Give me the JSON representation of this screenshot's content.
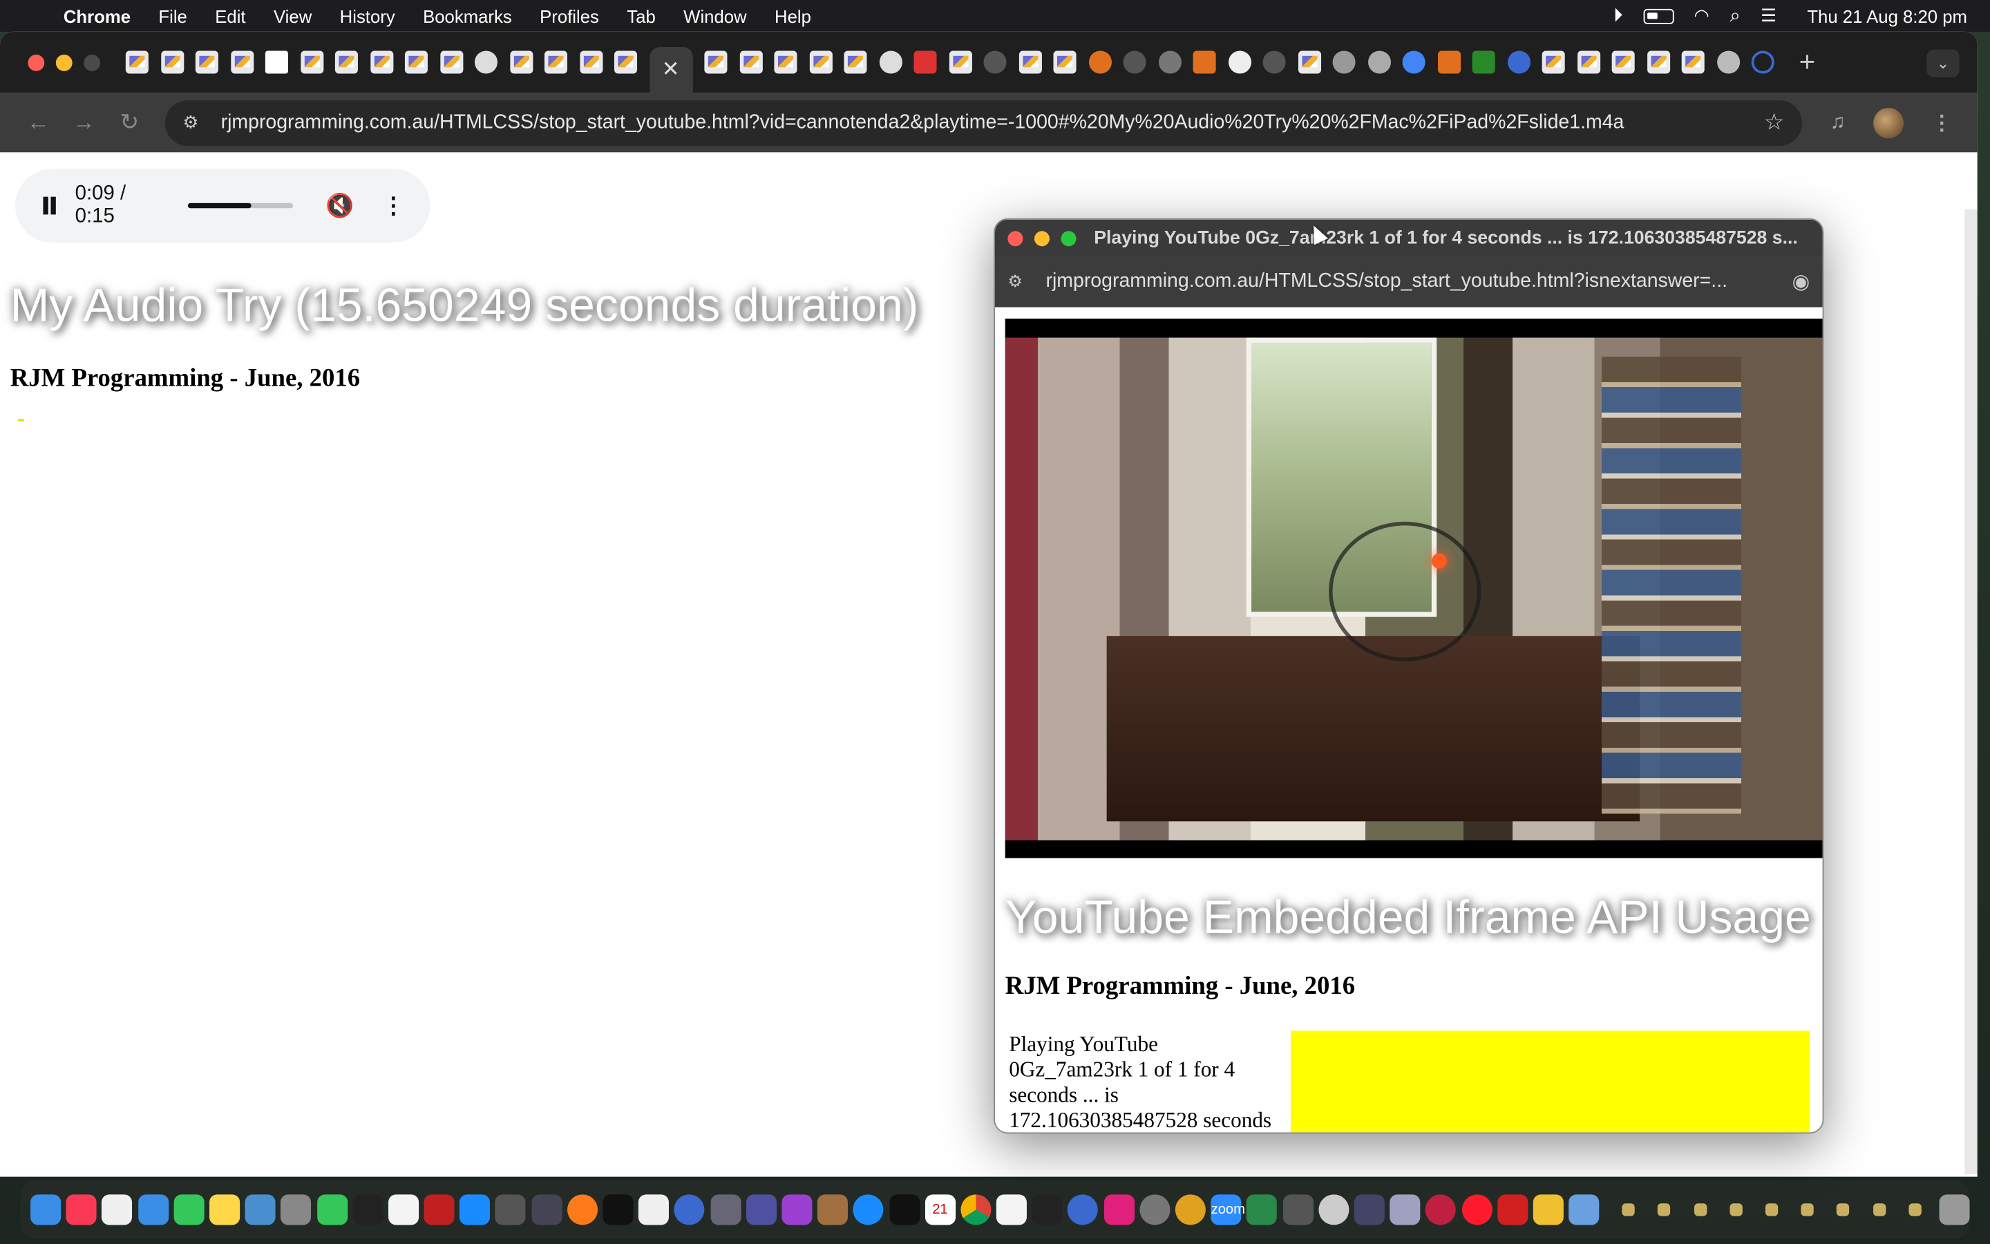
{
  "menubar": {
    "app_name": "Chrome",
    "menus": [
      "File",
      "Edit",
      "View",
      "History",
      "Bookmarks",
      "Profiles",
      "Tab",
      "Window",
      "Help"
    ],
    "clock": "Thu 21 Aug  8:20 pm",
    "status_icons": [
      "play-circle-icon",
      "battery-icon",
      "wifi-icon",
      "search-icon",
      "control-center-icon"
    ]
  },
  "browser": {
    "url": "rjmprogramming.com.au/HTMLCSS/stop_start_youtube.html?vid=cannotenda2&playtime=-1000#%20My%20Audio%20Try%20%2FMac%2FiPad%2Fslide1.m4a",
    "active_tab_icon": "close-icon",
    "new_tab_label": "+",
    "tab_search_label": "⌄"
  },
  "audio_player": {
    "time": "0:09 / 0:15",
    "progress_fraction": 0.6
  },
  "page": {
    "heading": "My Audio Try (15.650249 seconds duration)",
    "subheading": "RJM Programming - June, 2016"
  },
  "popup": {
    "title": "Playing YouTube 0Gz_7am23rk 1 of 1 for 4 seconds ... is 172.10630385487528 s...",
    "url": "rjmprogramming.com.au/HTMLCSS/stop_start_youtube.html?isnextanswer=...",
    "heading": "YouTube Embedded Iframe API Usage",
    "subheading": "RJM Programming - June, 2016",
    "status_text": "Playing YouTube 0Gz_7am23rk 1 of 1 for 4 seconds ... is 172.10630385487528 seconds"
  },
  "colors": {
    "accent_yellow": "#ffff00",
    "titlebar": "#3a3a3a"
  }
}
